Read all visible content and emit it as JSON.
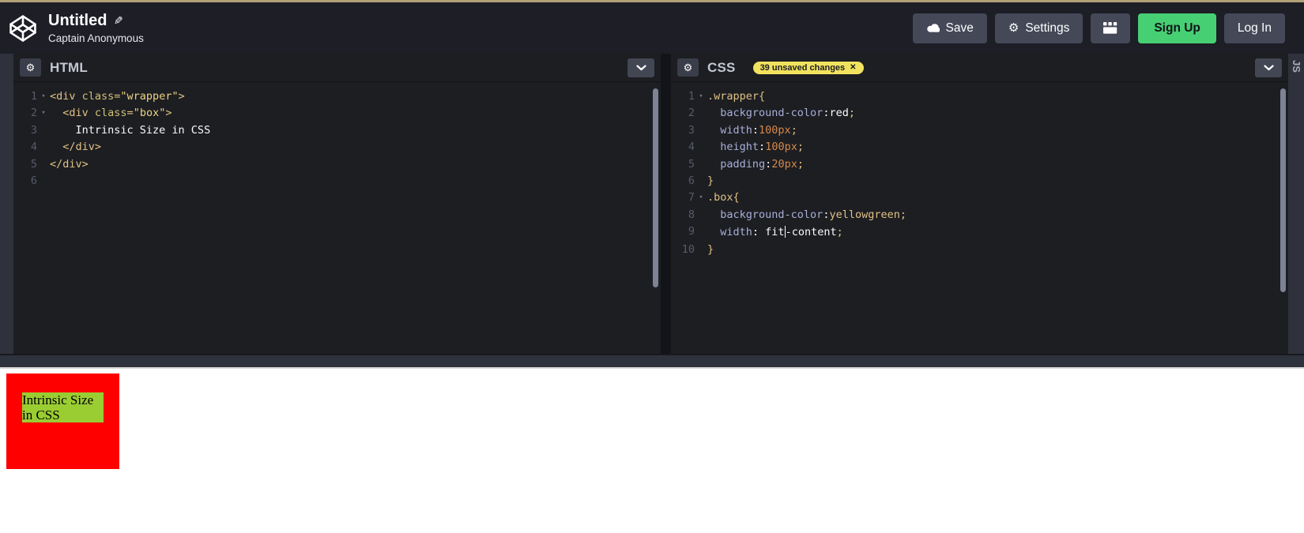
{
  "colors": {
    "topbar": "#b2a077",
    "signup": "#47cf73",
    "badge_bg": "#f2e35e",
    "preview_wrapper": "#ff0000",
    "preview_box": "#9acd32"
  },
  "header": {
    "title": "Untitled",
    "author": "Captain Anonymous",
    "save": "Save",
    "settings": "Settings",
    "sign_up": "Sign Up",
    "log_in": "Log In"
  },
  "panels": {
    "html": {
      "title": "HTML",
      "lines": [
        {
          "n": "1",
          "fold": true,
          "seg": [
            [
              "<div ",
              "t"
            ],
            [
              "class",
              "a"
            ],
            [
              "=",
              "t"
            ],
            [
              "\"wrapper\"",
              "s"
            ],
            [
              ">",
              "t"
            ]
          ]
        },
        {
          "n": "2",
          "fold": true,
          "seg": [
            [
              "  ",
              "p"
            ],
            [
              "<div ",
              "t"
            ],
            [
              "class",
              "a"
            ],
            [
              "=",
              "t"
            ],
            [
              "\"box\"",
              "s"
            ],
            [
              ">",
              "t"
            ]
          ]
        },
        {
          "n": "3",
          "seg": [
            [
              "    Intrinsic Size in CSS",
              "p"
            ]
          ]
        },
        {
          "n": "4",
          "seg": [
            [
              "  </div>",
              "t"
            ]
          ]
        },
        {
          "n": "5",
          "seg": [
            [
              "</div>",
              "t"
            ]
          ]
        },
        {
          "n": "6",
          "seg": []
        }
      ]
    },
    "css": {
      "title": "CSS",
      "badge": "39 unsaved changes",
      "badge_close": "✕",
      "lines": [
        {
          "n": "1",
          "fold": true,
          "seg": [
            [
              ".wrapper{",
              "t"
            ]
          ]
        },
        {
          "n": "2",
          "seg": [
            [
              "  ",
              "p"
            ],
            [
              "background-color",
              "r"
            ],
            [
              ":",
              "p"
            ],
            [
              "red",
              "p"
            ],
            [
              ";",
              "t"
            ]
          ]
        },
        {
          "n": "3",
          "seg": [
            [
              "  ",
              "p"
            ],
            [
              "width",
              "r"
            ],
            [
              ":",
              "p"
            ],
            [
              "100px",
              "n"
            ],
            [
              ";",
              "t"
            ]
          ]
        },
        {
          "n": "4",
          "seg": [
            [
              "  ",
              "p"
            ],
            [
              "height",
              "r"
            ],
            [
              ":",
              "p"
            ],
            [
              "100px",
              "n"
            ],
            [
              ";",
              "t"
            ]
          ]
        },
        {
          "n": "5",
          "seg": [
            [
              "  ",
              "p"
            ],
            [
              "padding",
              "r"
            ],
            [
              ":",
              "p"
            ],
            [
              "20px",
              "n"
            ],
            [
              ";",
              "t"
            ]
          ]
        },
        {
          "n": "6",
          "seg": [
            [
              "}",
              "t"
            ]
          ]
        },
        {
          "n": "7",
          "fold": true,
          "seg": [
            [
              ".box{",
              "t"
            ]
          ]
        },
        {
          "n": "8",
          "seg": [
            [
              "  ",
              "p"
            ],
            [
              "background-color",
              "r"
            ],
            [
              ":",
              "p"
            ],
            [
              "yellowgreen",
              "t"
            ],
            [
              ";",
              "t"
            ]
          ]
        },
        {
          "n": "9",
          "seg": [
            [
              "  ",
              "p"
            ],
            [
              "width",
              "r"
            ],
            [
              ": ",
              "p"
            ],
            [
              "fit",
              "p"
            ],
            [
              "",
              "c"
            ],
            [
              "-content",
              "p"
            ],
            [
              ";",
              "t"
            ]
          ]
        },
        {
          "n": "10",
          "seg": [
            [
              "}",
              "t"
            ]
          ]
        }
      ]
    },
    "js": {
      "title": "JS"
    }
  },
  "preview": {
    "box_text": "Intrinsic Size in CSS"
  }
}
